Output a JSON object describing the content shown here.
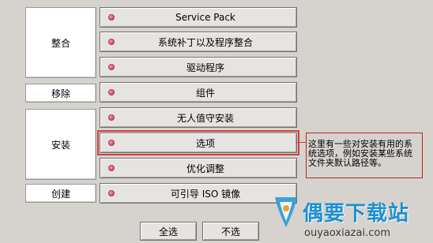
{
  "categories": [
    {
      "label": "整合"
    },
    {
      "label": "移除"
    },
    {
      "label": "安装"
    },
    {
      "label": "创建"
    }
  ],
  "buttons": [
    {
      "label": "Service Pack"
    },
    {
      "label": "系统补丁以及程序整合"
    },
    {
      "label": "驱动程序"
    },
    {
      "label": "组件"
    },
    {
      "label": "无人值守安装"
    },
    {
      "label": "选项"
    },
    {
      "label": "优化调整"
    },
    {
      "label": "可引导 ISO 镜像"
    }
  ],
  "tooltip": {
    "text": "这里有一些对安装有用的系统选项，例如安装某些系统文件夹默认路径等。"
  },
  "footer": {
    "select_all": "全选",
    "deselect": "不选"
  },
  "watermark": {
    "title": "偶要下载站",
    "url": "ouyaoxiazai.com"
  },
  "colors": {
    "highlight": "#d23c3c",
    "watermark": "#1e90cf"
  }
}
